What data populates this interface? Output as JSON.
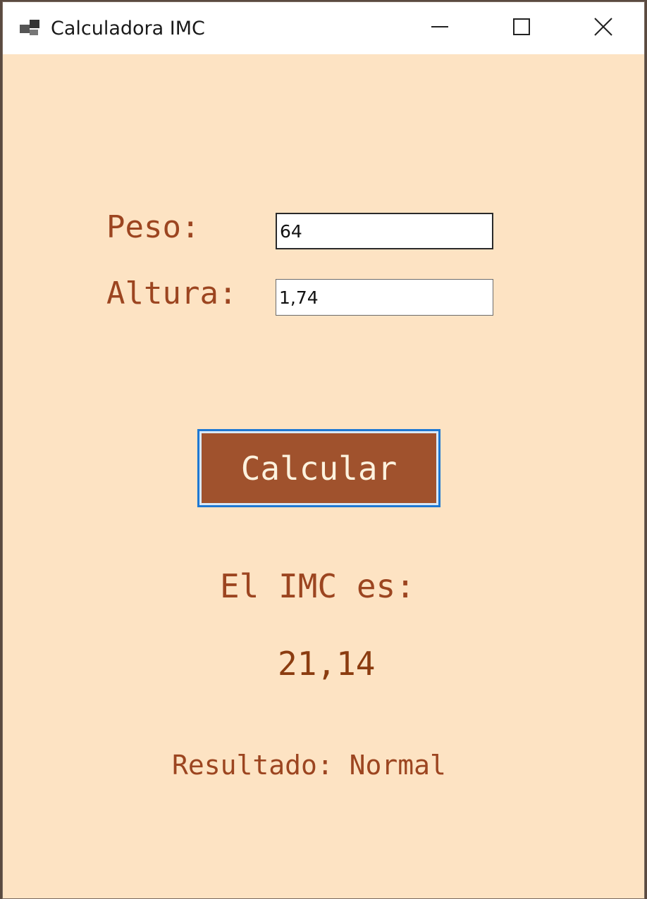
{
  "window": {
    "title": "Calculadora IMC",
    "icons": {
      "app": "app-window-icon",
      "minimize": "minimize-icon",
      "maximize": "maximize-icon",
      "close": "close-icon"
    }
  },
  "form": {
    "peso_label": "Peso:",
    "peso_value": "64",
    "altura_label": "Altura:",
    "altura_value": "1,74",
    "calculate_label": "Calcular"
  },
  "result": {
    "imc_label": "El IMC es:",
    "imc_value": "21,14",
    "resultado_text": "Resultado: Normal"
  },
  "colors": {
    "background": "#fde3c3",
    "label_text": "#9c4520",
    "button_bg": "#a0522d",
    "button_focus_border": "#1e78d2"
  }
}
